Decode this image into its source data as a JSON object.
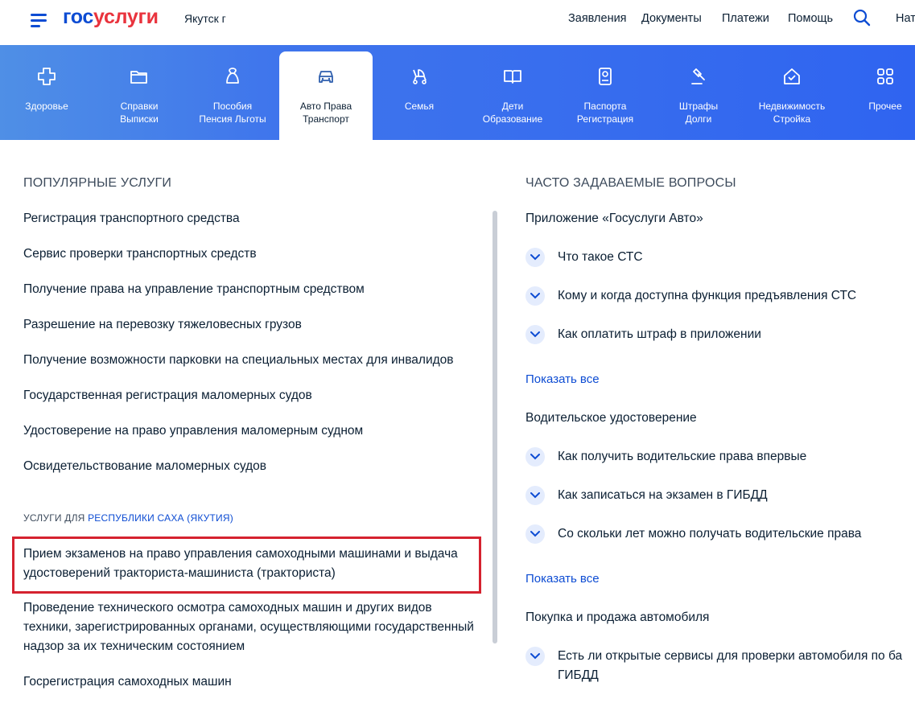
{
  "header": {
    "logo_part1": "гос",
    "logo_part2": "услуги",
    "city": "Якутск г",
    "nav": [
      "Заявления",
      "Документы",
      "Платежи",
      "Помощь"
    ],
    "extra": "Нат"
  },
  "categories": [
    {
      "label": "Здоровье",
      "icon": "health-cross-icon"
    },
    {
      "label": "Справки\nВыписки",
      "icon": "folder-icon"
    },
    {
      "label": "Пособия\nПенсия Льготы",
      "icon": "bag-icon"
    },
    {
      "label": "Авто Права\nТранспорт",
      "icon": "car-icon"
    },
    {
      "label": "Семья",
      "icon": "stroller-icon"
    },
    {
      "label": "Дети\nОбразование",
      "icon": "book-icon"
    },
    {
      "label": "Паспорта\nРегистрация",
      "icon": "passport-icon"
    },
    {
      "label": "Штрафы\nДолги",
      "icon": "gavel-icon"
    },
    {
      "label": "Недвижимость\nСтройка",
      "icon": "house-icon"
    },
    {
      "label": "Прочее",
      "icon": "grid-icon"
    }
  ],
  "popular": {
    "title": "ПОПУЛЯРНЫЕ УСЛУГИ",
    "items": [
      "Регистрация транспортного средства",
      "Сервис проверки транспортных средств",
      "Получение права на управление транспортным средством",
      "Разрешение на перевозку тяжеловесных грузов",
      "Получение возможности парковки на специальных местах для инвалидов",
      "Государственная регистрация маломерных судов",
      "Удостоверение на право управления маломерным судном",
      "Освидетельствование маломерных судов"
    ]
  },
  "regional": {
    "prefix": "УСЛУГИ ДЛЯ ",
    "region": "РЕСПУБЛИКИ САХА (ЯКУТИЯ)",
    "items": [
      "Прием экзаменов на право управления самоходными машинами и выдача удостоверений тракториста-машиниста (тракториста)",
      "Проведение технического осмотра самоходных машин и других видов техники, зарегистрированных органами, осуществляющими государственный надзор за их техническим состоянием",
      "Госрегистрация самоходных машин"
    ]
  },
  "faq": {
    "title": "ЧАСТО ЗАДАВАЕМЫЕ ВОПРОСЫ",
    "show_all": "Показать все",
    "groups": [
      {
        "title": "Приложение «Госуслуги Авто»",
        "questions": [
          "Что такое СТС",
          "Кому и когда доступна функция предъявления СТС",
          "Как оплатить штраф в приложении"
        ]
      },
      {
        "title": "Водительское удостоверение",
        "questions": [
          "Как получить водительские права впервые",
          "Как записаться на экзамен в ГИБДД",
          "Со скольки лет можно получать водительские права"
        ]
      },
      {
        "title": "Покупка и продажа автомобиля",
        "questions": [
          "Есть ли открытые сервисы для проверки автомобиля по ба\nГИБДД"
        ]
      }
    ]
  },
  "colors": {
    "brand_blue": "#0d4cd3",
    "brand_red": "#e9333d",
    "highlight": "#d5222f"
  }
}
